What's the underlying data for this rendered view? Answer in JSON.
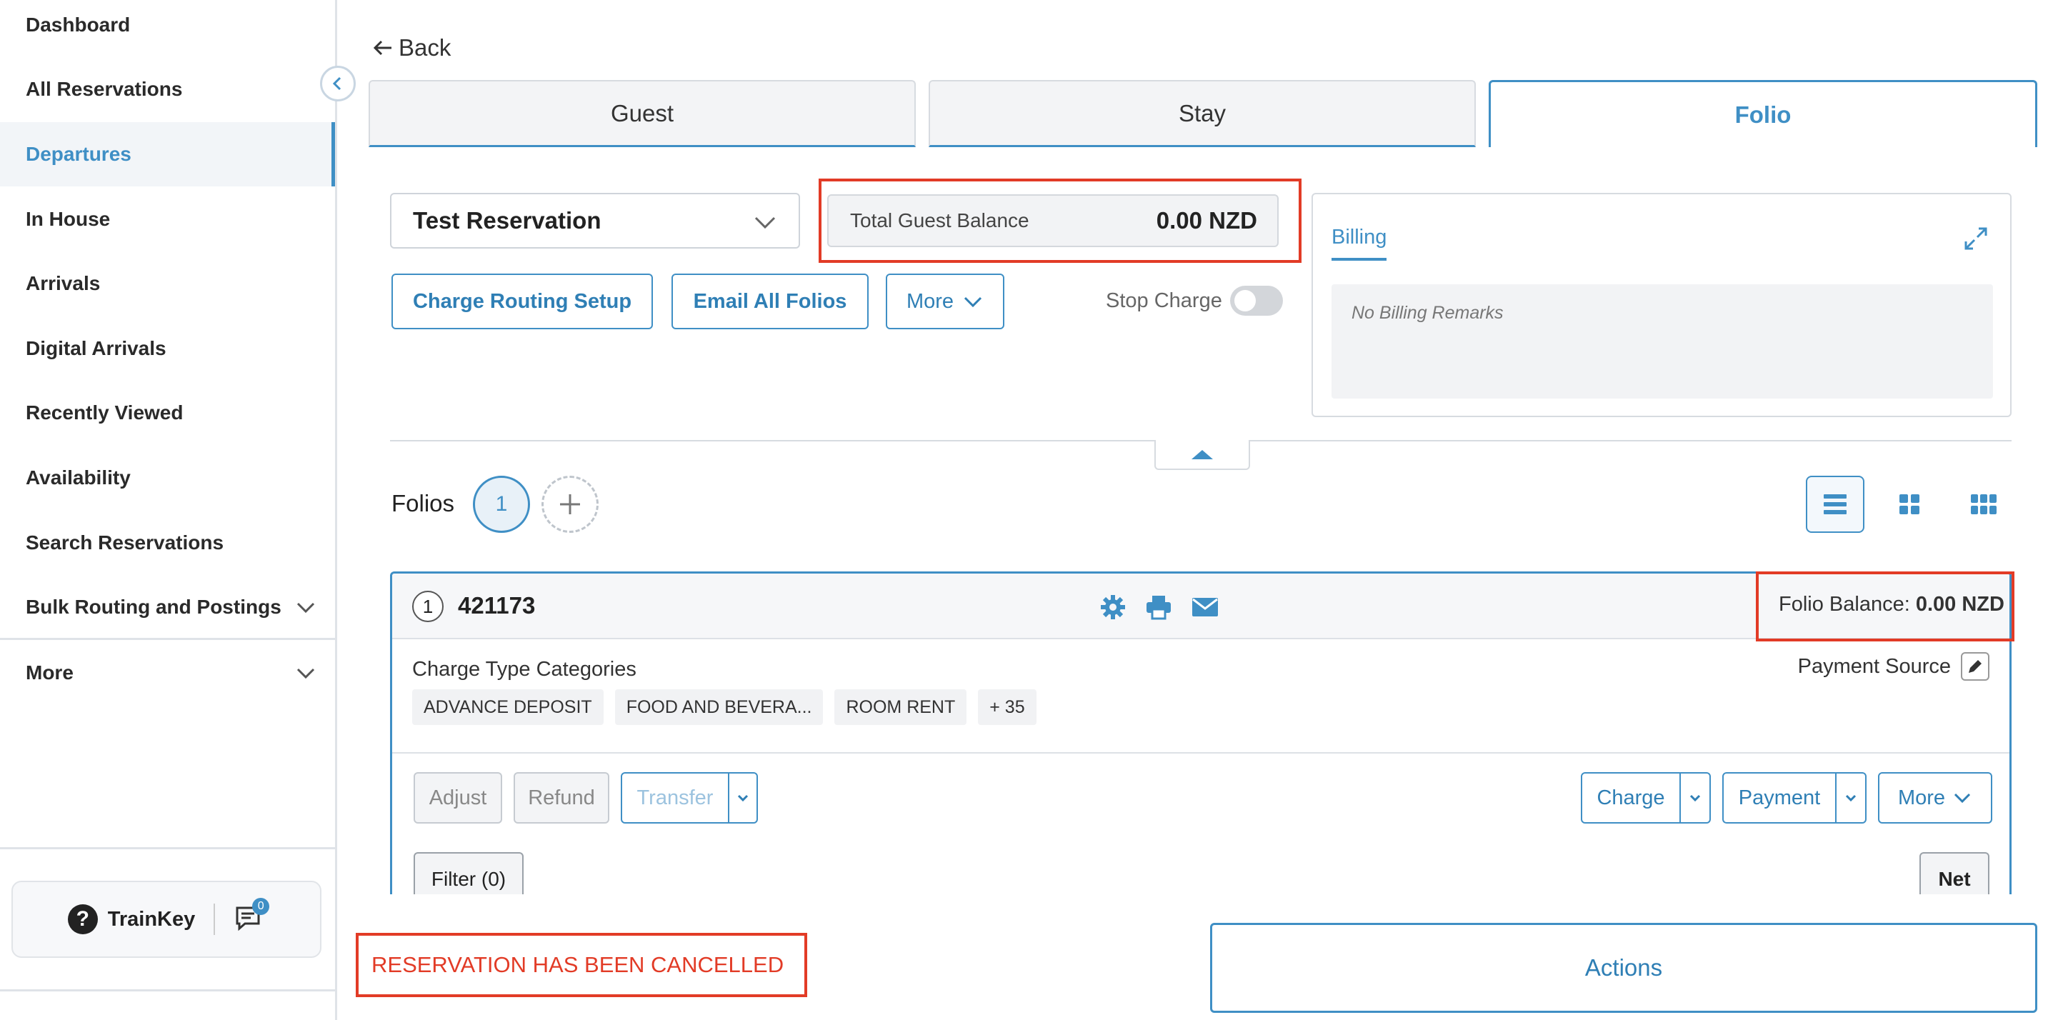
{
  "sidebar": {
    "items": [
      {
        "label": "Dashboard"
      },
      {
        "label": "All Reservations"
      },
      {
        "label": "Departures",
        "active": true
      },
      {
        "label": "In House"
      },
      {
        "label": "Arrivals"
      },
      {
        "label": "Digital Arrivals"
      },
      {
        "label": "Recently Viewed"
      },
      {
        "label": "Availability"
      },
      {
        "label": "Search Reservations"
      },
      {
        "label": "Bulk Routing and Postings",
        "expandable": true
      },
      {
        "label": "More",
        "expandable": true
      }
    ],
    "help": {
      "label": "TrainKey",
      "chat_count": "0"
    }
  },
  "header": {
    "back_label": "Back"
  },
  "tabs": [
    {
      "label": "Guest"
    },
    {
      "label": "Stay"
    },
    {
      "label": "Folio",
      "active": true
    }
  ],
  "reservation_select": {
    "value": "Test Reservation"
  },
  "balance": {
    "label": "Total Guest Balance",
    "value": "0.00 NZD"
  },
  "toolbar": {
    "charge_routing": "Charge Routing Setup",
    "email_all": "Email All Folios",
    "more": "More",
    "stop_charge": "Stop Charge"
  },
  "billing": {
    "tab": "Billing",
    "remarks": "No Billing Remarks"
  },
  "folios": {
    "label": "Folios",
    "active_number": "1"
  },
  "folio": {
    "number": "1",
    "id": "421173",
    "balance_label": "Folio Balance:",
    "balance_value": "0.00 NZD",
    "categories_title": "Charge Type Categories",
    "payment_source": "Payment Source",
    "chips": [
      "ADVANCE DEPOSIT",
      "FOOD AND BEVERA...",
      "ROOM RENT",
      "+ 35"
    ],
    "buttons": {
      "adjust": "Adjust",
      "refund": "Refund",
      "transfer": "Transfer",
      "charge": "Charge",
      "payment": "Payment",
      "more": "More",
      "filter": "Filter (0)",
      "net": "Net"
    }
  },
  "footer": {
    "cancel_banner": "RESERVATION HAS BEEN CANCELLED",
    "actions": "Actions"
  },
  "colors": {
    "accent": "#3f8fc5",
    "alert": "#e23b26"
  },
  "icons": [
    "chevron-left-icon",
    "arrow-left-icon",
    "chevron-down-icon",
    "expand-icon",
    "caret-up-icon",
    "plus-icon",
    "list-view-icon",
    "grid-view-icon",
    "compact-grid-icon",
    "gear-icon",
    "printer-icon",
    "mail-icon",
    "pencil-icon",
    "help-icon",
    "chat-icon"
  ]
}
